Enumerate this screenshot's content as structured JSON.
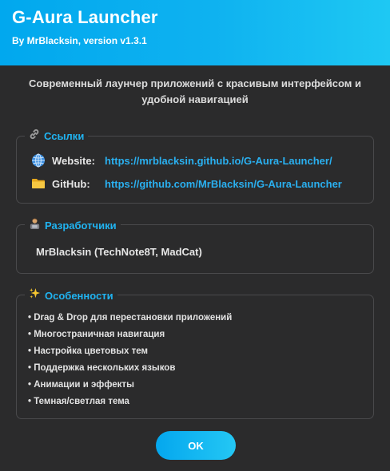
{
  "header": {
    "title": "G-Aura Launcher",
    "subtitle": "By MrBlacksin, version v1.3.1"
  },
  "description": "Современный лаунчер приложений с красивым интерфейсом и удобной навигацией",
  "links": {
    "legend": "Ссылки",
    "legend_icon": "link-icon",
    "items": [
      {
        "icon": "globe-icon",
        "label": "Website:",
        "url": "https://mrblacksin.github.io/G-Aura-Launcher/"
      },
      {
        "icon": "folder-icon",
        "label": "GitHub:",
        "url": "https://github.com/MrBlacksin/G-Aura-Launcher"
      }
    ]
  },
  "developers": {
    "legend": "Разработчики",
    "legend_icon": "developer-icon",
    "names": "MrBlacksin (TechNote8T, MadCat)"
  },
  "features": {
    "legend": "Особенности",
    "legend_icon": "sparkles-icon",
    "items": [
      "• Drag & Drop для перестановки приложений",
      "• Многостраничная навигация",
      "• Настройка цветовых тем",
      "• Поддержка нескольких языков",
      "• Анимации и эффекты",
      "• Темная/светлая тема"
    ]
  },
  "ok_button": "OK",
  "colors": {
    "accent": "#0fb2f0",
    "background": "#2b2b2c",
    "link": "#2ab0f0",
    "border": "#4a4a4c"
  }
}
